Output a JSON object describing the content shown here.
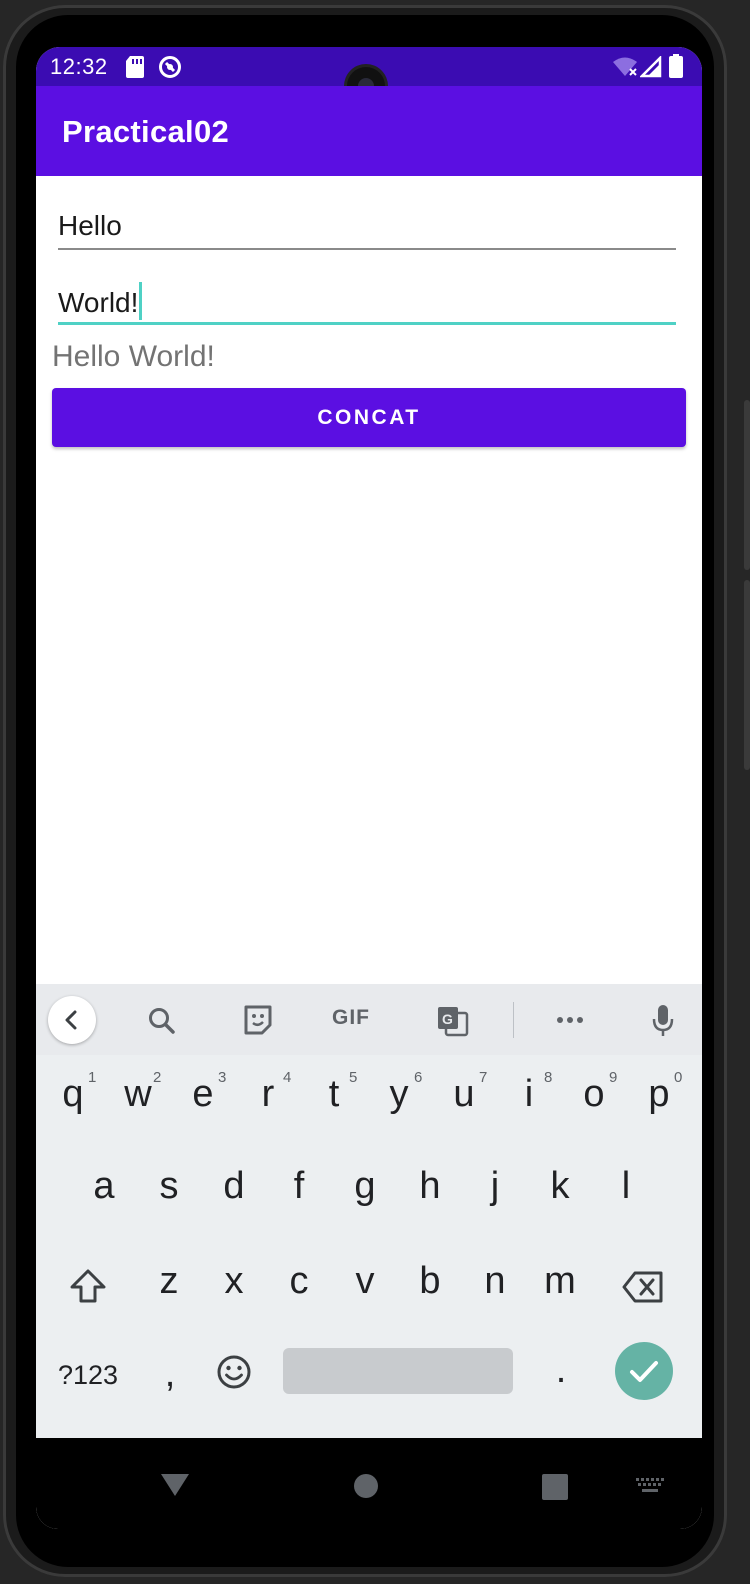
{
  "status_bar": {
    "time": "12:32",
    "left_icons": [
      "sd-card-icon",
      "do-not-disturb-icon"
    ],
    "right_icons": [
      "wifi-icon",
      "signal-icon",
      "battery-icon"
    ]
  },
  "app": {
    "title": "Practical02",
    "field1_value": "Hello",
    "field2_value": "World!",
    "result_text": "Hello World!",
    "button_label": "CONCAT",
    "colors": {
      "primary": "#5b0fe2",
      "status_bar": "#3b0cb2",
      "accent": "#4fd1c5"
    }
  },
  "keyboard": {
    "toolbar": [
      "back-icon",
      "search-icon",
      "sticker-icon",
      "GIF",
      "translate-icon",
      "more-icon",
      "mic-icon"
    ],
    "gif_label": "GIF",
    "row1": [
      {
        "key": "q",
        "hint": "1"
      },
      {
        "key": "w",
        "hint": "2"
      },
      {
        "key": "e",
        "hint": "3"
      },
      {
        "key": "r",
        "hint": "4"
      },
      {
        "key": "t",
        "hint": "5"
      },
      {
        "key": "y",
        "hint": "6"
      },
      {
        "key": "u",
        "hint": "7"
      },
      {
        "key": "i",
        "hint": "8"
      },
      {
        "key": "o",
        "hint": "9"
      },
      {
        "key": "p",
        "hint": "0"
      }
    ],
    "row2": [
      "a",
      "s",
      "d",
      "f",
      "g",
      "h",
      "j",
      "k",
      "l"
    ],
    "row3": [
      "z",
      "x",
      "c",
      "v",
      "b",
      "n",
      "m"
    ],
    "symbols_label": "?123",
    "comma": ",",
    "period": "."
  },
  "nav": [
    "back-icon",
    "home-icon",
    "recents-icon",
    "keyboard-switch-icon"
  ]
}
